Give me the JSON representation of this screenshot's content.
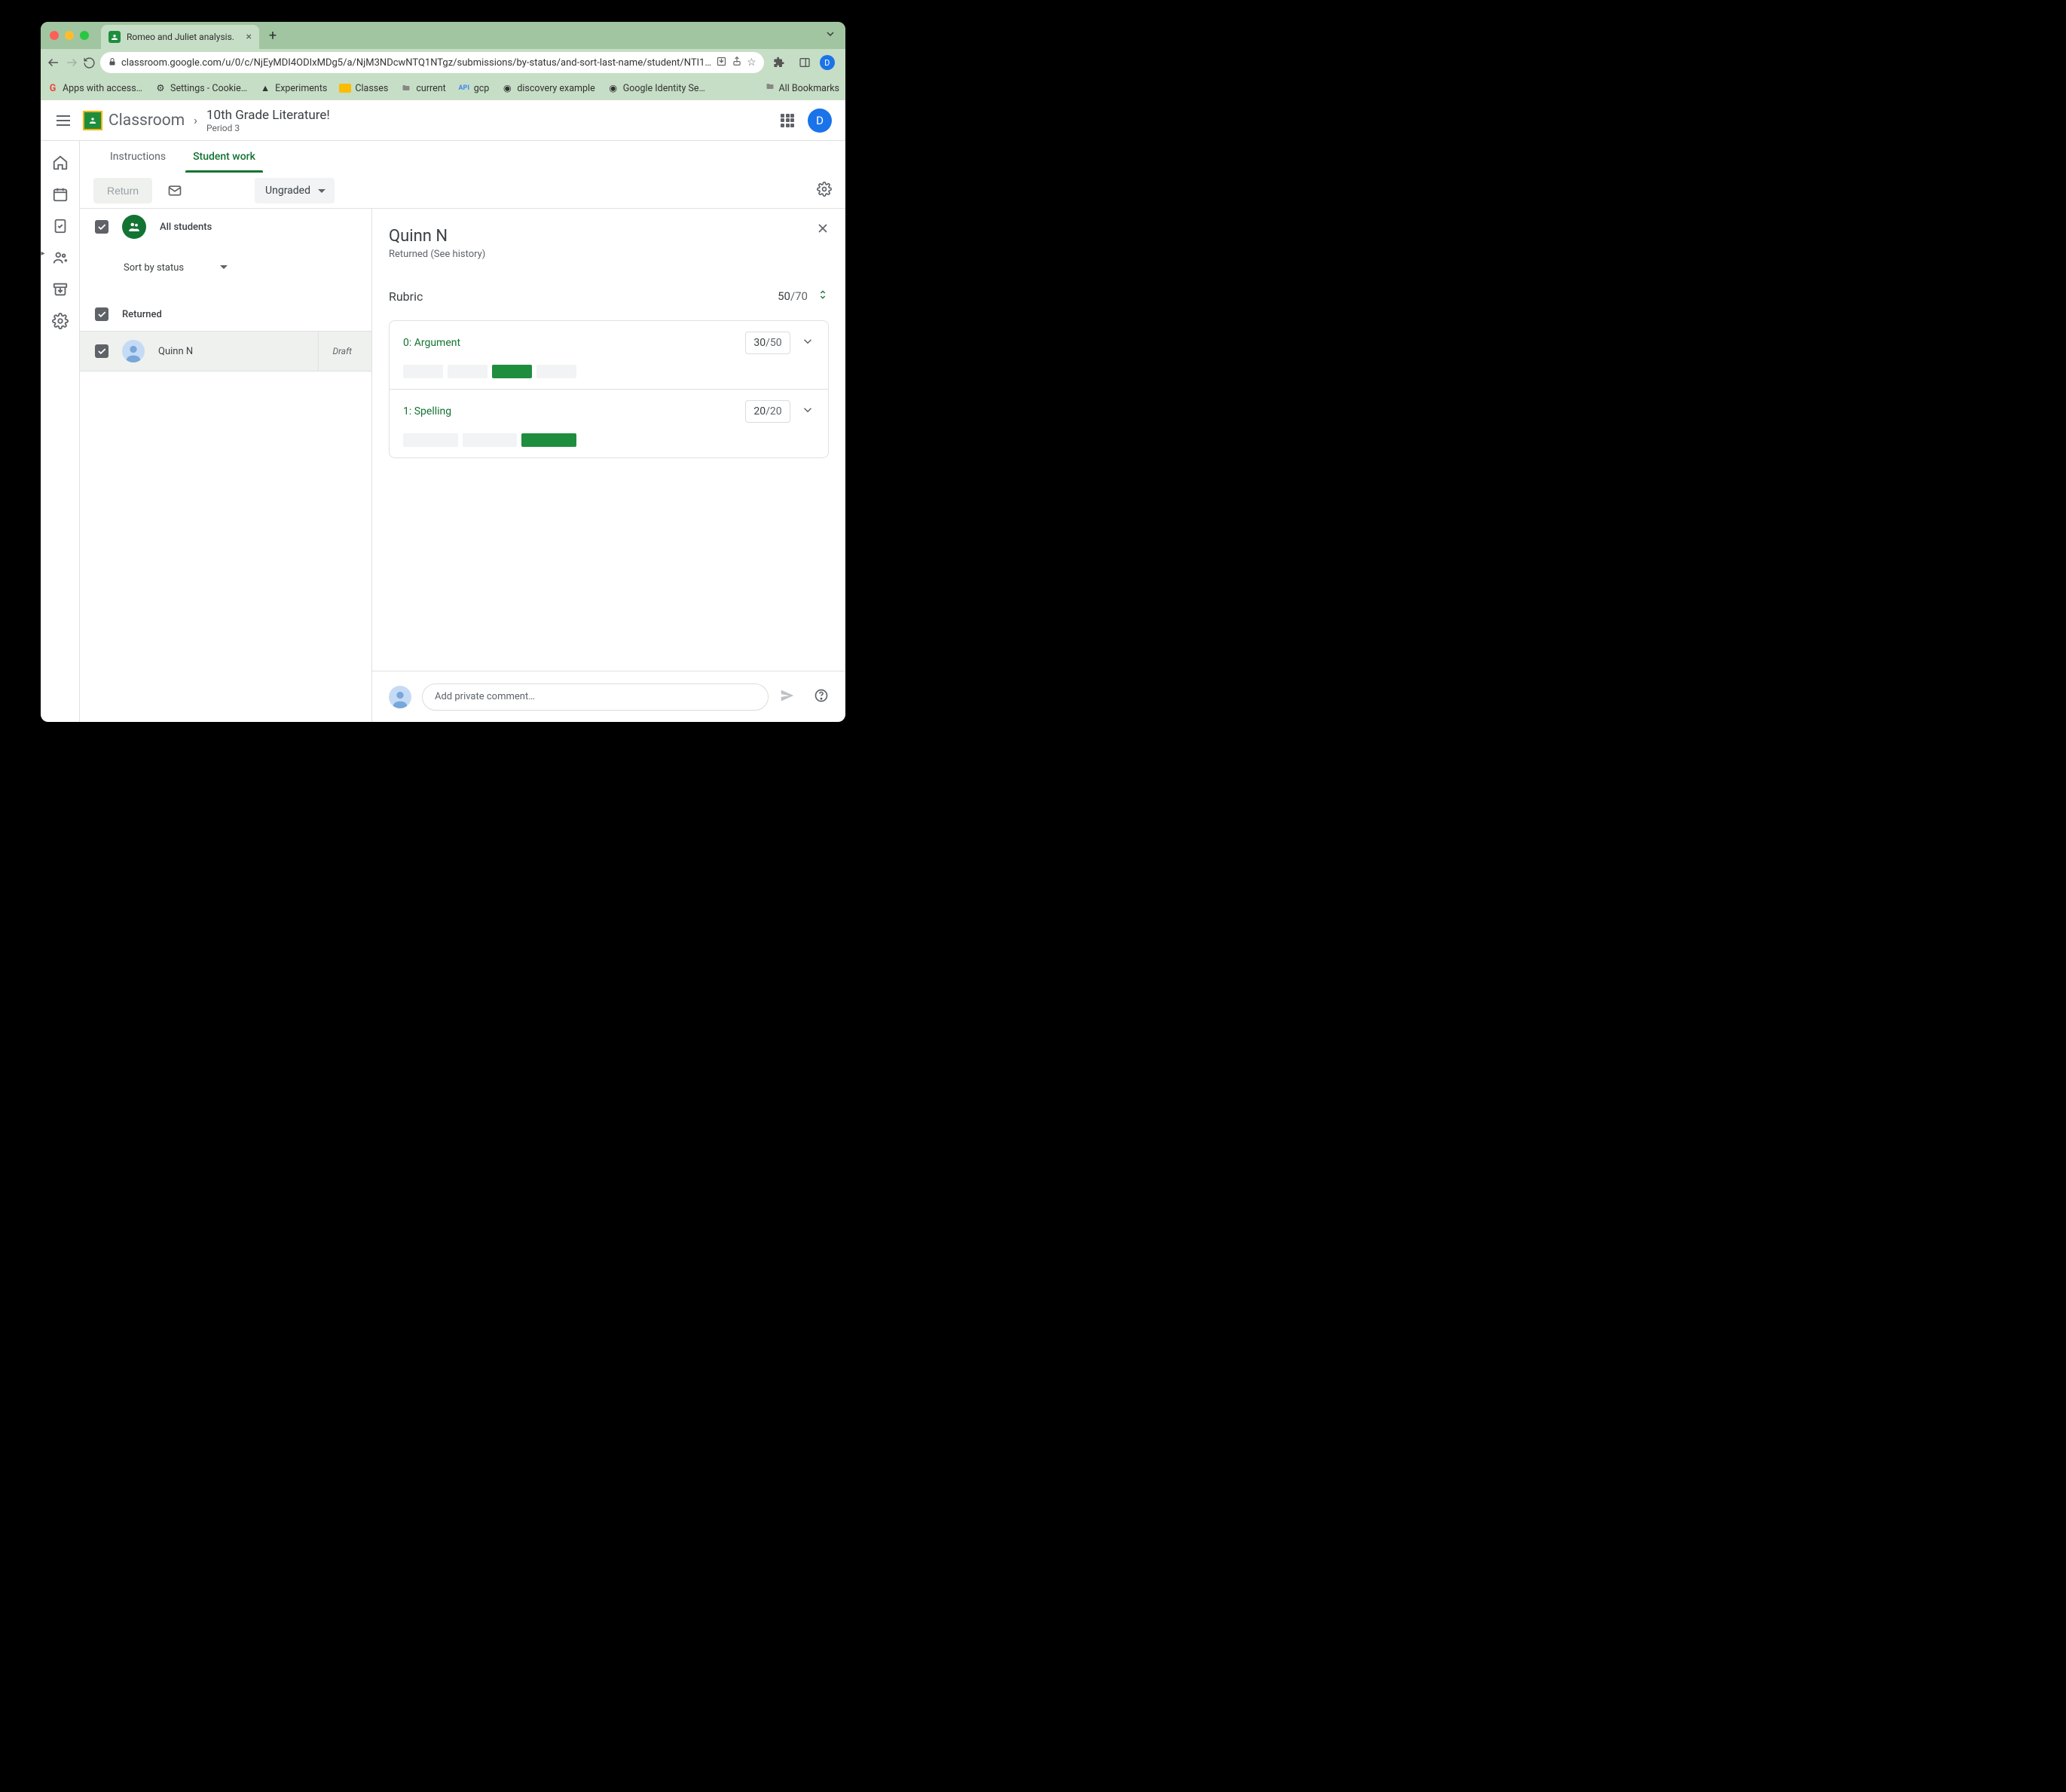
{
  "browser": {
    "tab_title": "Romeo and Juliet analysis.",
    "url": "classroom.google.com/u/0/c/NjEyMDI4ODIxMDg5/a/NjM3NDcwNTQ1NTgz/submissions/by-status/and-sort-last-name/student/NTI1…",
    "bookmarks": [
      "Apps with access…",
      "Settings - Cookie…",
      "Experiments",
      "Classes",
      "current",
      "gcp",
      "discovery example",
      "Google Identity Se…"
    ],
    "all_bookmarks": "All Bookmarks",
    "avatar_letter": "D"
  },
  "header": {
    "app_name": "Classroom",
    "class_title": "10th Grade Literature!",
    "class_subtitle": "Period 3",
    "avatar_letter": "D"
  },
  "tabs": {
    "instructions": "Instructions",
    "student_work": "Student work"
  },
  "toolbar": {
    "return_label": "Return",
    "filter_label": "Ungraded"
  },
  "left_pane": {
    "all_students": "All students",
    "sort_label": "Sort by status",
    "section": "Returned",
    "student_name": "Quinn N",
    "student_status": "Draft"
  },
  "right_pane": {
    "student_name": "Quinn N",
    "status_text": "Returned (See history)",
    "rubric_title": "Rubric",
    "score_earned": "50",
    "score_total": "/70",
    "criteria": [
      {
        "title": "0: Argument",
        "earned": "30",
        "total": "/50",
        "active_idx": 2,
        "bar_count": 4
      },
      {
        "title": "1: Spelling",
        "earned": "20",
        "total": "/20",
        "active_idx": 2,
        "bar_count": 3
      }
    ],
    "comment_placeholder": "Add private comment…"
  }
}
